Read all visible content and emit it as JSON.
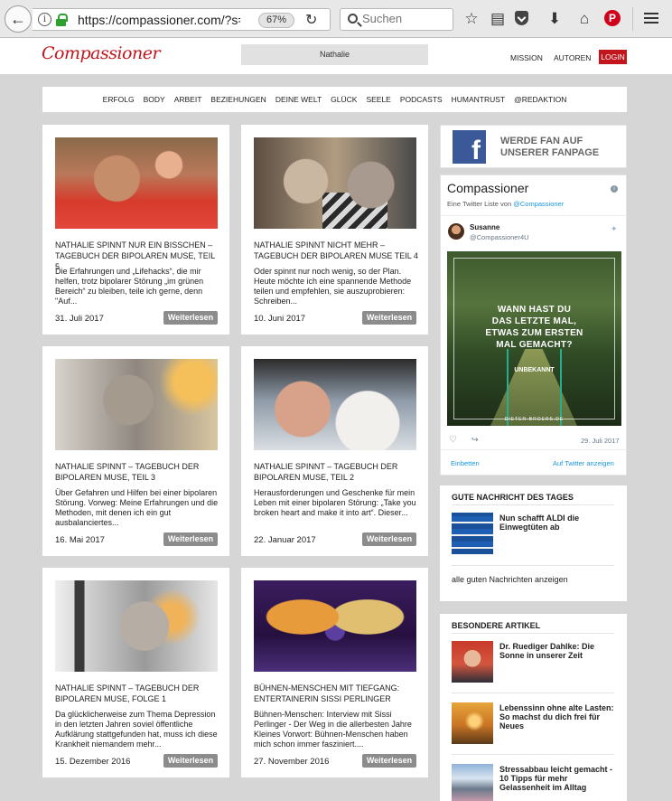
{
  "browser": {
    "url": "https://compassioner.com/?s=N",
    "zoom": "67%",
    "search_placeholder": "Suchen",
    "pinterest_glyph": "P"
  },
  "site": {
    "logo_text": "Compassioner",
    "search_value": "Nathalie",
    "header_links": [
      "MISSION",
      "AUTOREN"
    ],
    "login_label": "LOGIN",
    "accent_color": "#c2151c"
  },
  "nav": [
    "ERFOLG",
    "BODY",
    "ARBEIT",
    "BEZIEHUNGEN",
    "DEINE WELT",
    "GLÜCK",
    "SEELE",
    "PODCASTS",
    "HUMANTRUST",
    "@REDAKTION"
  ],
  "articles": [
    {
      "title": "NATHALIE SPINNT NUR EIN BISSCHEN – TAGEBUCH DER BIPOLAREN MUSE, TEIL 5",
      "excerpt": "Die Erfahrungen und „Lifehacks“, die mir helfen, trotz bipolarer Störung „im grünen Bereich“ zu bleiben, teile ich gerne, denn \"Auf...",
      "date": "31. Juli 2017",
      "more": "Weiterlesen"
    },
    {
      "title": "NATHALIE SPINNT NICHT MEHR – TAGEBUCH DER BIPOLAREN MUSE TEIL 4",
      "excerpt": "Oder spinnt nur noch wenig, so der Plan. Heute möchte ich eine spannende Methode teilen und empfehlen, sie auszuprobieren: Schreiben...",
      "date": "10. Juni 2017",
      "more": "Weiterlesen"
    },
    {
      "title": "NATHALIE SPINNT – TAGEBUCH DER BIPOLAREN MUSE, TEIL 3",
      "excerpt": "Über Gefahren und Hilfen bei einer bipolaren Störung. Vorweg: Meine Erfahrungen und die Methoden, mit denen ich ein gut ausbalanciertes...",
      "date": "16. Mai 2017",
      "more": "Weiterlesen"
    },
    {
      "title": "NATHALIE SPINNT – TAGEBUCH DER BIPOLAREN MUSE, TEIL 2",
      "excerpt": "Herausforderungen und Geschenke für mein Leben mit einer bipolaren Störung: „Take you broken heart and make it into art“. Dieser...",
      "date": "22. Januar 2017",
      "more": "Weiterlesen"
    },
    {
      "title": "NATHALIE SPINNT – TAGEBUCH DER BIPOLAREN MUSE, FOLGE 1",
      "excerpt": "Da glücklicherweise zum Thema Depression in den letzten Jahren soviel öffentliche Aufklärung stattgefunden hat, muss ich diese Krankheit niemandem mehr...",
      "date": "15. Dezember 2016",
      "more": "Weiterlesen"
    },
    {
      "title": "BÜHNEN-MENSCHEN MIT TIEFGANG: ENTERTAINERIN SISSI PERLINGER",
      "excerpt": "  Bühnen-Menschen:  Interview mit Sissi Perlinger -  Der Weg in die allerbesten Jahre Kleines Vorwort:  Bühnen-Menschen haben mich schon immer fasziniert....",
      "date": "27. November 2016",
      "more": "Weiterlesen"
    }
  ],
  "sidebar": {
    "facebook": {
      "glyph": "f",
      "line1": "WERDE FAN AUF",
      "line2": "UNSERER FANPAGE"
    },
    "twitter": {
      "title": "Compassioner",
      "info_glyph": "i",
      "subtitle_prefix": "Eine Twitter Liste von",
      "subtitle_handle": "@Compassioner",
      "user_name": "Susanne",
      "user_handle": "@Compassioner4U",
      "quote_line1": "WANN HAST DU",
      "quote_line2": "DAS LETZTE MAL,",
      "quote_line3": "ETWAS ZUM ERSTEN",
      "quote_line4": "MAL GEMACHT?",
      "quote_author": "UNBEKANNT",
      "image_credit": "DIETER-BROERS.DE",
      "date": "29. Juli 2017",
      "embed_label": "Einbetten",
      "view_label": "Auf Twitter anzeigen"
    },
    "good_news": {
      "heading": "GUTE NACHRICHT DES TAGES",
      "item_title": "Nun schafft ALDI die Einwegtüten ab",
      "more_label": "alle guten Nachrichten anzeigen"
    },
    "special": {
      "heading": "BESONDERE ARTIKEL",
      "items": [
        "Dr. Ruediger Dahlke: Die Sonne in unserer Zeit",
        "Lebenssinn ohne alte Lasten: So machst du dich frei für Neues",
        "Stressabbau leicht gemacht - 10 Tipps für mehr Gelassenheit im Alltag"
      ]
    }
  }
}
